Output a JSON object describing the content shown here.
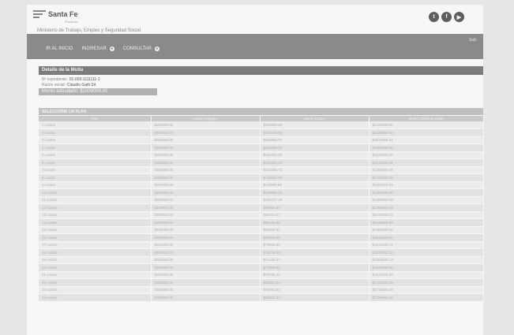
{
  "header": {
    "brand": "Santa Fe",
    "brand_sub": "Provincia",
    "ministry": "Ministerio de Trabajo, Empleo y Seguridad Social",
    "socials": [
      {
        "icon": "twitter-icon",
        "glyph": "t"
      },
      {
        "icon": "facebook-icon",
        "glyph": "f"
      },
      {
        "icon": "youtube-icon",
        "glyph": "▶"
      }
    ]
  },
  "nav": {
    "salir": "Salir",
    "items": [
      {
        "label": "IR AL INICIO",
        "dot": false
      },
      {
        "label": "INGRESAR",
        "dot": true
      },
      {
        "label": "CONSULTAR",
        "dot": true
      }
    ]
  },
  "detalle": {
    "title": "Detalle de la Multa",
    "expediente_label": "Nº expediente:",
    "expediente_value": "01-003-1111111-1",
    "razon_label": "Razón social:",
    "razon_value": "Claudio Gatti Srl",
    "monto": "Monto adeudado: $1000000.00"
  },
  "plan": {
    "title": "SELECCIONE UN PLAN",
    "columns": [
      "Plan",
      "Monto Anticipo",
      "Monto Cuota",
      "Monto total financiado"
    ],
    "rows": [
      [
        "1 cuotas",
        "$200000.00",
        "$826000.00",
        "$1026000.00"
      ],
      [
        "2 cuotas",
        "$200000.00",
        "$424000.00",
        "$1048000.00"
      ],
      [
        "3 cuotas",
        "$200000.00",
        "$290666.67",
        "$1072000.01"
      ],
      [
        "4 cuotas",
        "$200000.00",
        "$224000.00",
        "$1096000.00"
      ],
      [
        "5 cuotas",
        "$200000.00",
        "$184000.00",
        "$1120000.00"
      ],
      [
        "6 cuotas",
        "$200000.00",
        "$157333.34",
        "$1144000.04"
      ],
      [
        "7 cuotas",
        "$200000.00",
        "$142285.72",
        "$1196000.04"
      ],
      [
        "8 cuotas",
        "$200000.00",
        "$128000.00",
        "$1224000.00"
      ],
      [
        "9 cuotas",
        "$200000.00",
        "$118888.89",
        "$1251000.01"
      ],
      [
        "10 cuotas",
        "$200000.00",
        "$108000.00",
        "$1280000.00"
      ],
      [
        "11 cuotas",
        "$200000.00",
        "$100727.28",
        "$1308000.08"
      ],
      [
        "12 cuotas",
        "$200000.00",
        "$96666.67",
        "$1356000.04"
      ],
      [
        "13 cuotas",
        "$200000.00",
        "$92518.27",
        "$1416000.11"
      ],
      [
        "14 cuotas",
        "$200000.00",
        "$89142.86",
        "$1448000.04"
      ],
      [
        "15 cuotas",
        "$200000.00",
        "$85333.34",
        "$1480000.10"
      ],
      [
        "16 cuotas",
        "$200000.00",
        "$82000.00",
        "$1512000.00"
      ],
      [
        "17 cuotas",
        "$200000.00",
        "$79058.83",
        "$1544000.11"
      ],
      [
        "18 cuotas",
        "$200000.00",
        "$76444.45",
        "$1576000.10"
      ],
      [
        "19 cuotas",
        "$200000.00",
        "$74105.27",
        "$1608000.13"
      ],
      [
        "20 cuotas",
        "$200000.00",
        "$72000.00",
        "$1640000.00"
      ],
      [
        "21 cuotas",
        "$200000.00",
        "$70095.24",
        "$1672000.04"
      ],
      [
        "22 cuotas",
        "$200000.00",
        "$68363.64",
        "$1704000.08"
      ],
      [
        "23 cuotas",
        "$200000.00",
        "$66782.61",
        "$1736000.03"
      ],
      [
        "24 cuotas",
        "$200000.00",
        "$65333.34",
        "$1768000.16"
      ]
    ]
  }
}
